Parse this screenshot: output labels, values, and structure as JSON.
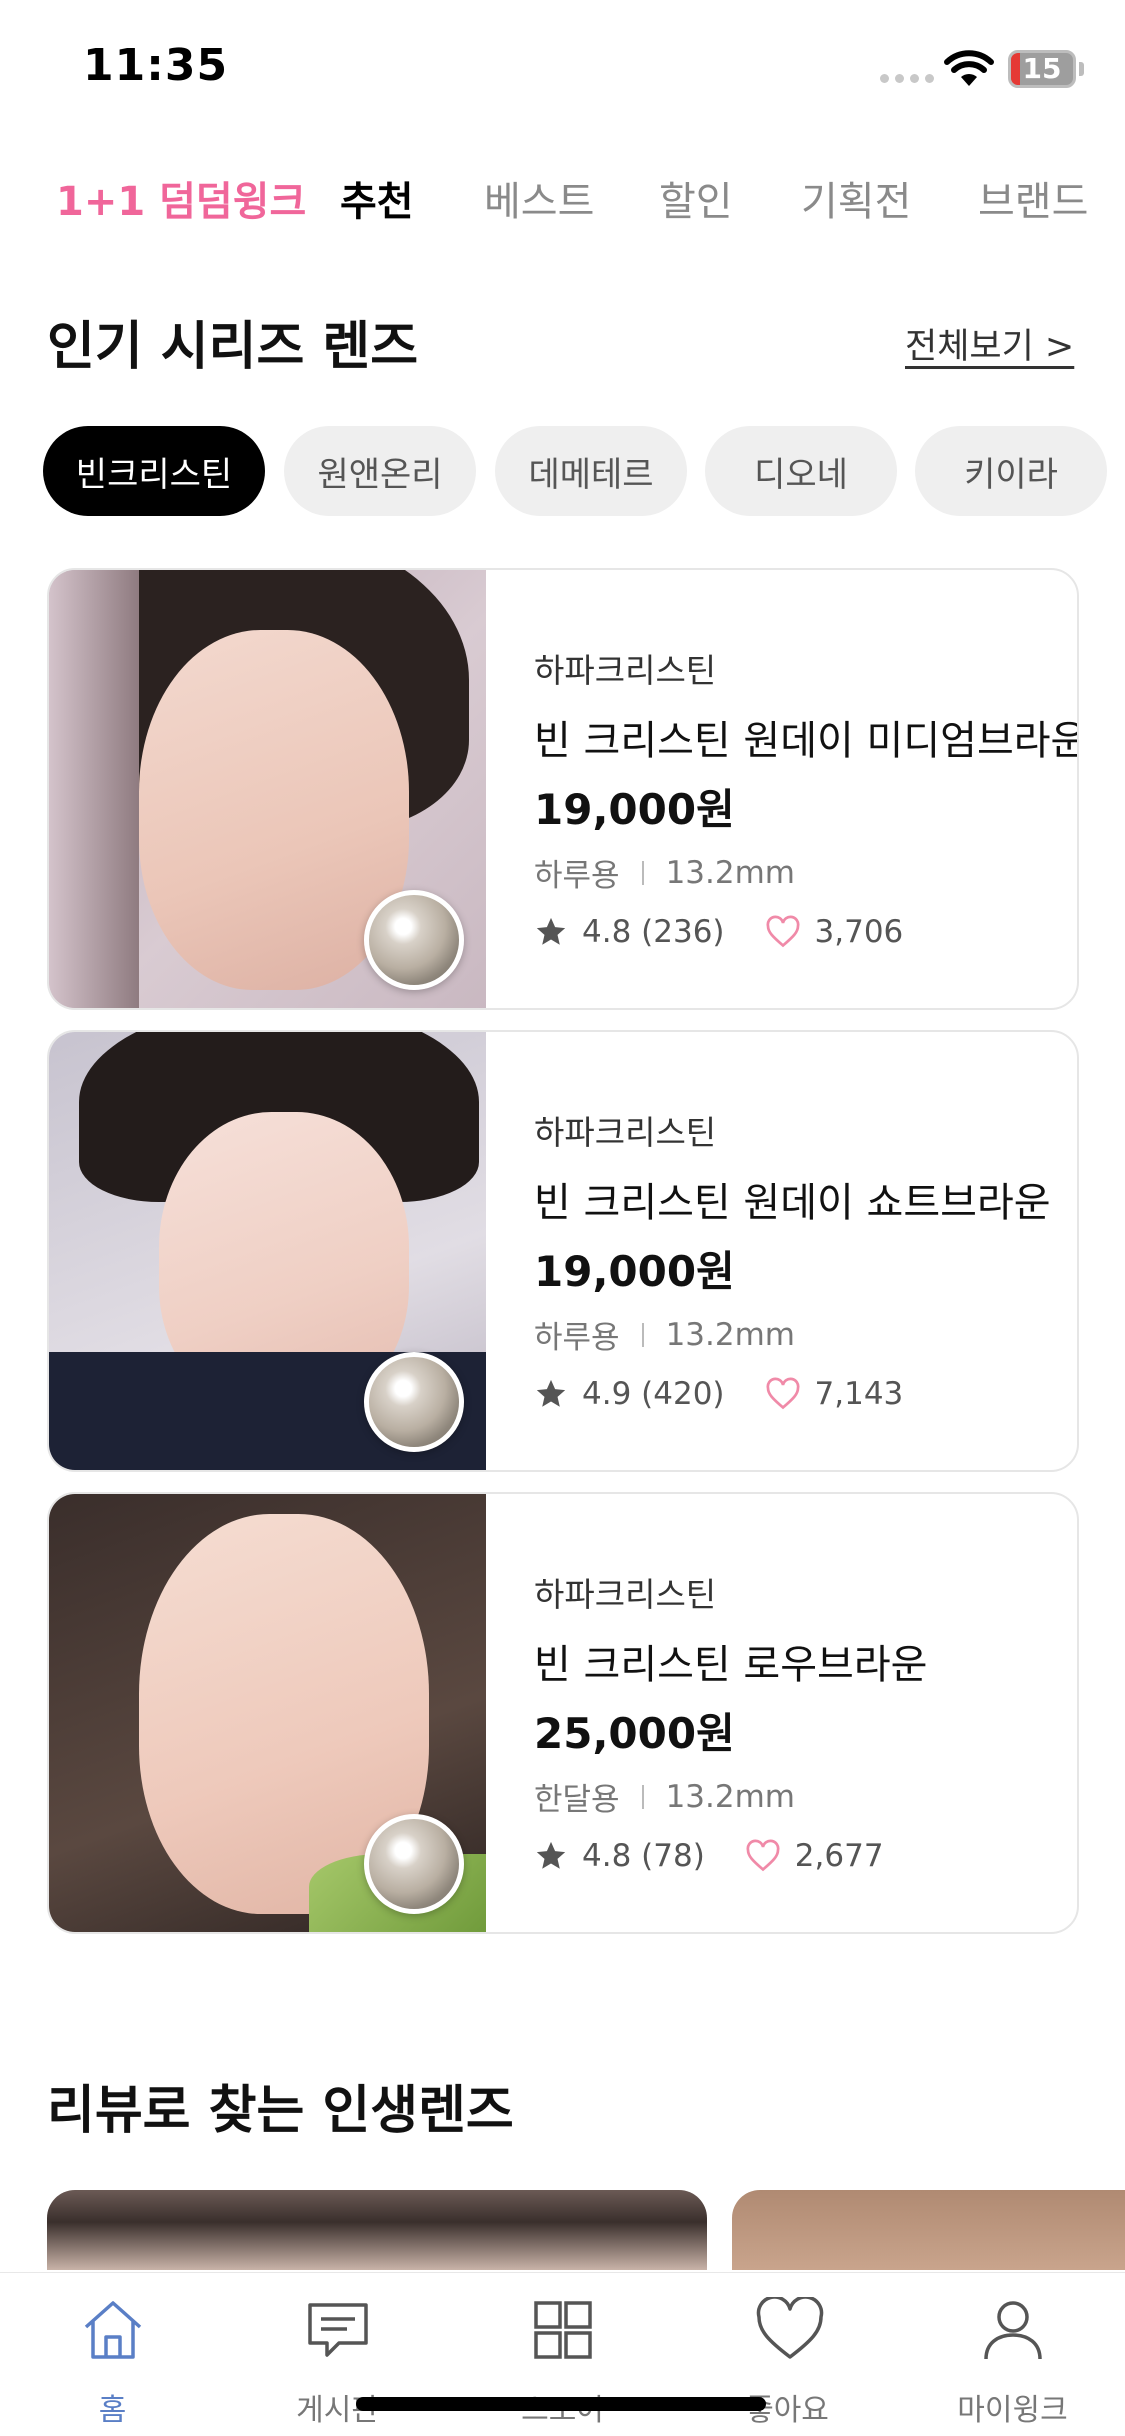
{
  "status_bar": {
    "time": "11:35",
    "battery": "15",
    "battery_level_percent": 15
  },
  "top_tabs": [
    {
      "label": "1+1 덤덤윙크",
      "state": "promo"
    },
    {
      "label": "추천",
      "state": "active"
    },
    {
      "label": "베스트",
      "state": "normal"
    },
    {
      "label": "할인",
      "state": "normal"
    },
    {
      "label": "기획전",
      "state": "normal"
    },
    {
      "label": "브랜드",
      "state": "normal"
    }
  ],
  "popular_section": {
    "title": "인기 시리즈 렌즈",
    "view_all": "전체보기 >",
    "chips": [
      {
        "label": "빈크리스틴",
        "selected": true
      },
      {
        "label": "원앤온리",
        "selected": false
      },
      {
        "label": "데메테르",
        "selected": false
      },
      {
        "label": "디오네",
        "selected": false
      },
      {
        "label": "키이라",
        "selected": false
      }
    ],
    "products": [
      {
        "brand": "하파크리스틴",
        "name": "빈 크리스틴 원데이 미디엄브라운",
        "price": "19,000원",
        "usage": "하루용",
        "diameter": "13.2mm",
        "rating": "4.8 (236)",
        "likes": "3,706"
      },
      {
        "brand": "하파크리스틴",
        "name": "빈 크리스틴 원데이 쇼트브라운",
        "price": "19,000원",
        "usage": "하루용",
        "diameter": "13.2mm",
        "rating": "4.9 (420)",
        "likes": "7,143"
      },
      {
        "brand": "하파크리스틴",
        "name": "빈 크리스틴 로우브라운",
        "price": "25,000원",
        "usage": "한달용",
        "diameter": "13.2mm",
        "rating": "4.8 (78)",
        "likes": "2,677"
      }
    ]
  },
  "review_section": {
    "title": "리뷰로 찾는 인생렌즈"
  },
  "bottom_nav": [
    {
      "label": "홈",
      "icon": "home-icon",
      "active": true
    },
    {
      "label": "게시판",
      "icon": "chat-icon",
      "active": false
    },
    {
      "label": "스토어",
      "icon": "grid-icon",
      "active": false
    },
    {
      "label": "좋아요",
      "icon": "heart-icon",
      "active": false
    },
    {
      "label": "마이윙크",
      "icon": "person-icon",
      "active": false
    }
  ],
  "colors": {
    "accent_pink": "#f0669a",
    "active_nav": "#5a7fc6",
    "heart": "#f08aa8"
  }
}
